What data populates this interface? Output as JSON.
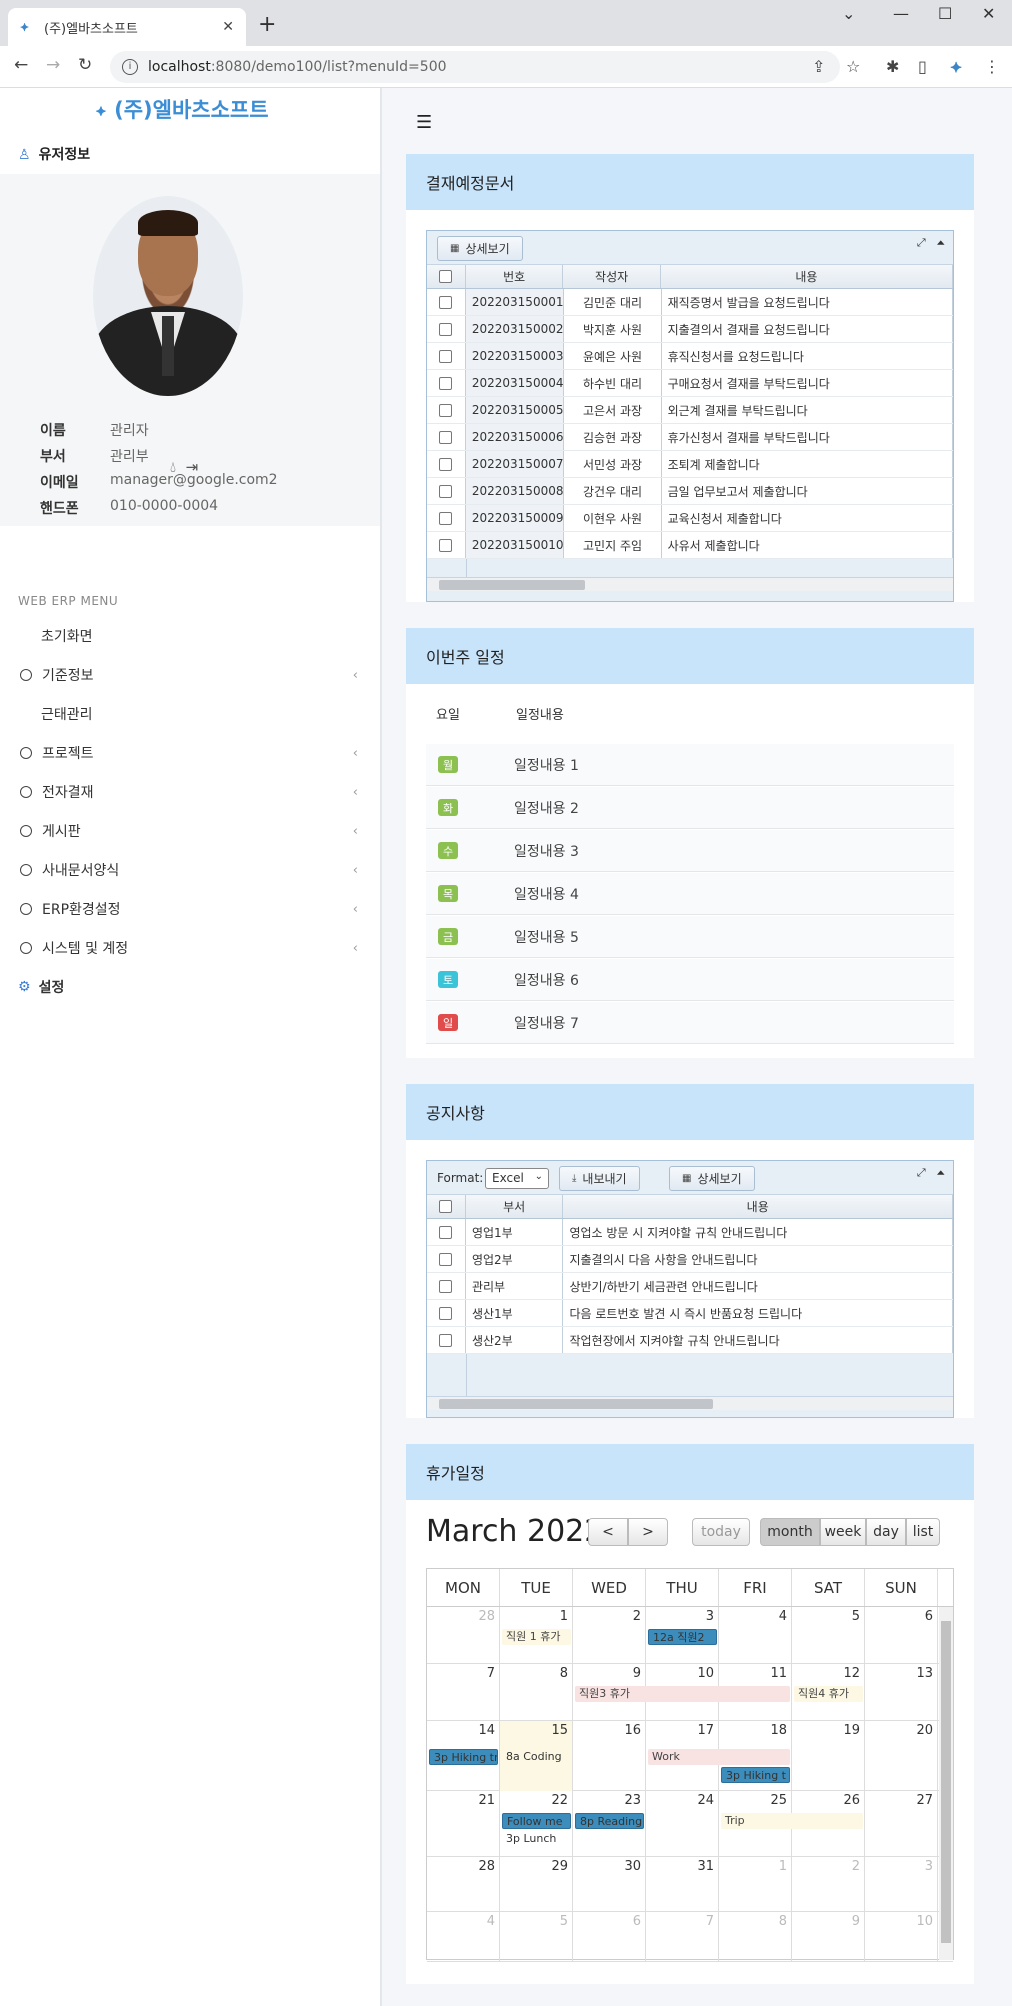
{
  "browser": {
    "tab_title": "(주)엘바츠소프트",
    "tab_close": "✕",
    "new_tab": "+",
    "url_host": "localhost",
    "url_path": ":8080/demo100/list?menuId=500"
  },
  "sidebar": {
    "brand": "(주)엘바츠소프트",
    "user_header": "유저정보",
    "profile": {
      "name_label": "이름",
      "name_value": "관리자",
      "dept_label": "부서",
      "dept_value": "관리부",
      "email_label": "이메일",
      "email_value": "manager@google.com2",
      "phone_label": "핸드폰",
      "phone_value": "010-0000-0004"
    },
    "menu_title": "WEB ERP MENU",
    "items": [
      {
        "label": "초기화면"
      },
      {
        "label": "기준정보"
      },
      {
        "label": "근태관리"
      },
      {
        "label": "프로젝트"
      },
      {
        "label": "전자결재"
      },
      {
        "label": "게시판"
      },
      {
        "label": "사내문서양식"
      },
      {
        "label": "ERP환경설정"
      },
      {
        "label": "시스템 및 계정"
      },
      {
        "label": "설정"
      }
    ]
  },
  "approval": {
    "title": "결재예정문서",
    "detail_btn": "상세보기",
    "headers": {
      "num": "번호",
      "writer": "작성자",
      "content": "내용"
    },
    "rows": [
      {
        "num": "202203150001",
        "writer": "김민준 대리",
        "content": "재직증명서 발급을 요청드립니다"
      },
      {
        "num": "202203150002",
        "writer": "박지훈 사원",
        "content": "지출결의서 결재를 요청드립니다"
      },
      {
        "num": "202203150003",
        "writer": "윤예은 사원",
        "content": "휴직신청서를 요청드립니다"
      },
      {
        "num": "202203150004",
        "writer": "하수빈 대리",
        "content": "구매요청서 결재를 부탁드립니다"
      },
      {
        "num": "202203150005",
        "writer": "고은서 과장",
        "content": "외근계 결재를 부탁드립니다"
      },
      {
        "num": "202203150006",
        "writer": "김승현 과장",
        "content": "휴가신청서 결재를 부탁드립니다"
      },
      {
        "num": "202203150007",
        "writer": "서민성 과장",
        "content": "조퇴계 제출합니다"
      },
      {
        "num": "202203150008",
        "writer": "강건우 대리",
        "content": "금일 업무보고서 제출합니다"
      },
      {
        "num": "202203150009",
        "writer": "이현우 사원",
        "content": "교육신청서 제출합니다"
      },
      {
        "num": "202203150010",
        "writer": "고민지 주임",
        "content": "사유서 제출합니다"
      }
    ]
  },
  "schedule": {
    "title": "이번주 일정",
    "col_day": "요일",
    "col_content": "일정내용",
    "rows": [
      {
        "day": "월",
        "color": "#8cc152",
        "content": "일정내용 1"
      },
      {
        "day": "화",
        "color": "#8cc152",
        "content": "일정내용 2"
      },
      {
        "day": "수",
        "color": "#8cc152",
        "content": "일정내용 3"
      },
      {
        "day": "목",
        "color": "#8cc152",
        "content": "일정내용 4"
      },
      {
        "day": "금",
        "color": "#8cc152",
        "content": "일정내용 5"
      },
      {
        "day": "토",
        "color": "#3bc4d8",
        "content": "일정내용 6"
      },
      {
        "day": "일",
        "color": "#e04b4b",
        "content": "일정내용 7"
      }
    ]
  },
  "notice": {
    "title": "공지사항",
    "format_label": "Format:",
    "format_value": "Excel",
    "export_btn": "내보내기",
    "detail_btn": "상세보기",
    "headers": {
      "dept": "부서",
      "content": "내용"
    },
    "rows": [
      {
        "dept": "영업1부",
        "content": "영업소 방문 시 지켜야할 규칙 안내드립니다"
      },
      {
        "dept": "영업2부",
        "content": "지출결의시 다음 사항을 안내드립니다"
      },
      {
        "dept": "관리부",
        "content": "상반기/하반기 세금관련 안내드립니다"
      },
      {
        "dept": "생산1부",
        "content": "다음 로트번호 발견 시 즉시 반품요청 드립니다"
      },
      {
        "dept": "생산2부",
        "content": "작업현장에서 지켜야할 규칙 안내드립니다"
      }
    ]
  },
  "vacation": {
    "title": "휴가일정",
    "month_title": "March 2022",
    "prev": "<",
    "next": ">",
    "today": "today",
    "views": [
      "month",
      "week",
      "day",
      "list"
    ],
    "weekdays": [
      "MON",
      "TUE",
      "WED",
      "THU",
      "FRI",
      "SAT",
      "SUN"
    ],
    "weeks": [
      [
        "28",
        "1",
        "2",
        "3",
        "4",
        "5",
        "6"
      ],
      [
        "7",
        "8",
        "9",
        "10",
        "11",
        "12",
        "13"
      ],
      [
        "14",
        "15",
        "16",
        "17",
        "18",
        "19",
        "20"
      ],
      [
        "21",
        "22",
        "23",
        "24",
        "25",
        "26",
        "27"
      ],
      [
        "28",
        "29",
        "30",
        "31",
        "1",
        "2",
        "3"
      ],
      [
        "4",
        "5",
        "6",
        "7",
        "8",
        "9",
        "10"
      ]
    ],
    "events": {
      "e1": "직원 1 휴가",
      "e2": "12a 직원2",
      "e3": "직원3 휴가",
      "e4": "직원4 휴가",
      "e5": "3p Hiking tr",
      "e6": "8a Coding",
      "e7": "Work",
      "e8": "3p Hiking t",
      "e9": "Follow me",
      "e10": "8p Reading",
      "e11": "3p Lunch",
      "e12": "Trip"
    }
  }
}
